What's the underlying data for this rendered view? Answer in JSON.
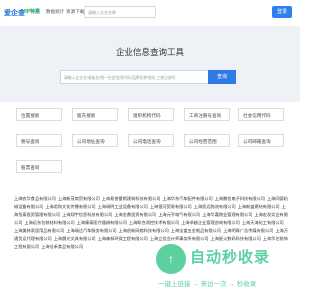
{
  "header": {
    "logo": "爱企查",
    "vip": "VIP特惠",
    "nav": [
      "数据统计",
      "资源下载"
    ],
    "search_placeholder": "请输入企业名称",
    "login": "登录"
  },
  "hero": {
    "title": "企业信息查询工具",
    "placeholder": "请输入企业名/老板名/统一社会信用代码/品牌名称/地址 工商注册号",
    "button": "查询"
  },
  "categories": [
    "位置搜索",
    "股东搜索",
    "组织机构代码",
    "工商注册号查询",
    "社会信用代码",
    "税号查询",
    "公司地址查询",
    "公司电话查询",
    "公司经营范围",
    "公司邮箱查询",
    "股票查询"
  ],
  "company_links": [
    "上海农华食品有限公司",
    "上海新茂商贸有限公司",
    "上海易普雷斯建筑科技有限公司",
    "上海华东汽车配件有限公司",
    "上海鹏信电子科技有限公司",
    "上海同德机械设备有限公司",
    "上海君和文化传播有限公司",
    "上海瑞明工业设备有限公司",
    "上海银河贸易有限公司",
    "上海凯远物流有限公司",
    "上海新盛建材有限公司",
    "上海恒泰投资管理有限公司",
    "上海翔宇信息科技有限公司",
    "上海金鼎投资有限公司",
    "上海元亨电气有限公司",
    "上海华嘉物业管理有限公司",
    "上海宏发实业有限公司",
    "上海远东包装材料有限公司",
    "上海康泰医疗器械有限公司",
    "上海联合测控技术有限公司",
    "上海卓越企业管理咨询有限公司",
    "上海天海化工有限公司",
    "上海美林家居用品有限公司",
    "上海瑞达汽车服务有限公司",
    "上海创新网络科技有限公司",
    "上海宝盛五金制品有限公司",
    "上海明珠广告传媒有限公司",
    "上海万通货运代理有限公司",
    "上海晨光文具有限公司",
    "上海森林环保工程有限公司",
    "上海立信会计师事务所有限公司",
    "上海星火数码科技有限公司",
    "上海华艺装饰工程有限公司",
    "上海佳禾食品有限公司"
  ],
  "watermark": {
    "brand": "自动秒收录",
    "sub": "一键上链接 → 来访一次 → 秒收录"
  },
  "colors": {
    "primary": "#2f7be5",
    "hero_bg": "#eef2f7",
    "watermark": "#5dd0a0"
  }
}
